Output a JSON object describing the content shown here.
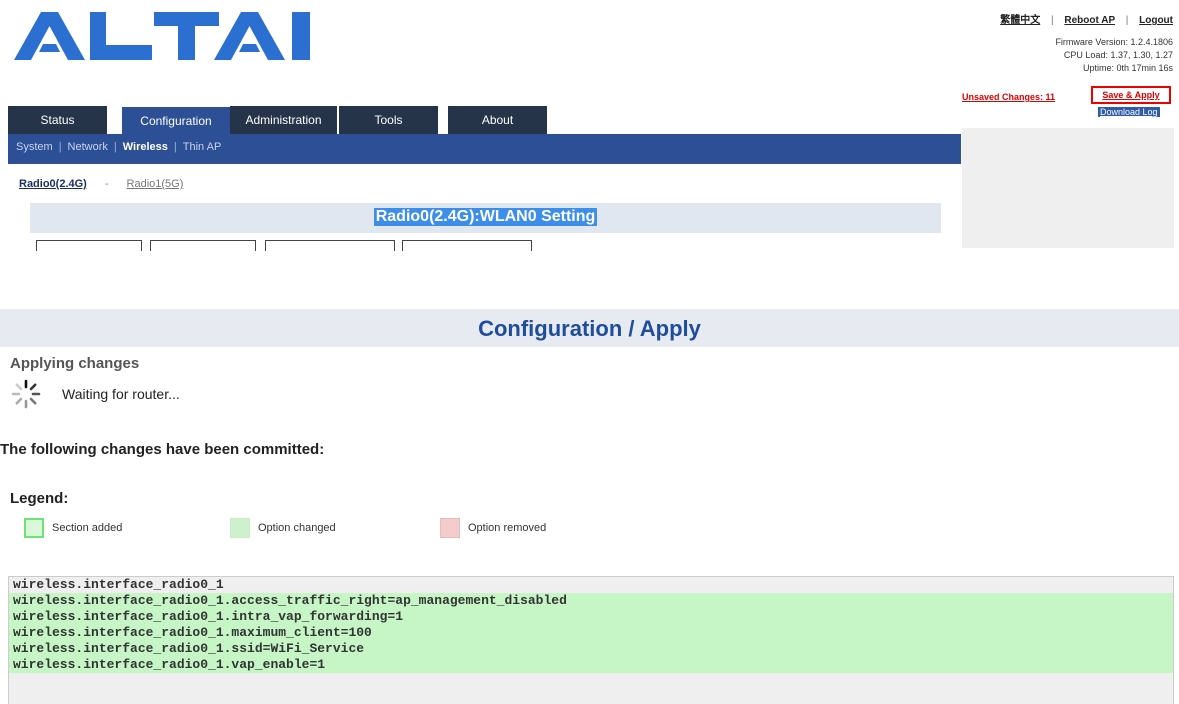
{
  "header": {
    "logo_text": "ALTAI",
    "lang_link": "繁體中文",
    "reboot_link": "Reboot AP",
    "logout_link": "Logout",
    "sep": "|",
    "firmware": "Firmware Version: 1.2.4.1806",
    "cpu_load": "CPU Load: 1.37, 1.30, 1.27",
    "uptime": "Uptime: 0th 17min 16s",
    "unsaved": "Unsaved Changes: 11",
    "save_apply": "Save & Apply",
    "download_log": "Download Log"
  },
  "tabs": [
    "Status",
    "Configuration",
    "Administration",
    "Tools",
    "About"
  ],
  "subnav": {
    "items": [
      "System",
      "Network",
      "Wireless",
      "Thin AP"
    ],
    "sep": "|"
  },
  "radio_tabs": {
    "r0": "Radio0(2.4G)",
    "dash": "-",
    "r1": "Radio1(5G)"
  },
  "wlan_title": "Radio0(2.4G):WLAN0 Setting",
  "apply": {
    "header": "Configuration / Apply",
    "applying": "Applying changes",
    "waiting": "Waiting for router...",
    "committed": "The following changes have been committed:",
    "legend_title": "Legend:",
    "legend": [
      "Section added",
      "Option changed",
      "Option removed"
    ]
  },
  "changes": [
    {
      "text": "wireless.interface_radio0_1",
      "type": "plain"
    },
    {
      "text": "wireless.interface_radio0_1.access_traffic_right=ap_management_disabled",
      "type": "changed"
    },
    {
      "text": "wireless.interface_radio0_1.intra_vap_forwarding=1",
      "type": "changed"
    },
    {
      "text": "wireless.interface_radio0_1.maximum_client=100",
      "type": "changed"
    },
    {
      "text": "wireless.interface_radio0_1.ssid=WiFi_Service",
      "type": "changed"
    },
    {
      "text": "wireless.interface_radio0_1.vap_enable=1",
      "type": "changed"
    }
  ],
  "colors": {
    "brand_blue": "#2b6fd1",
    "nav_dark": "#253448",
    "nav_active": "#2c4f95",
    "changed_green": "#c6f6c6",
    "alert_red": "#dd0000"
  }
}
